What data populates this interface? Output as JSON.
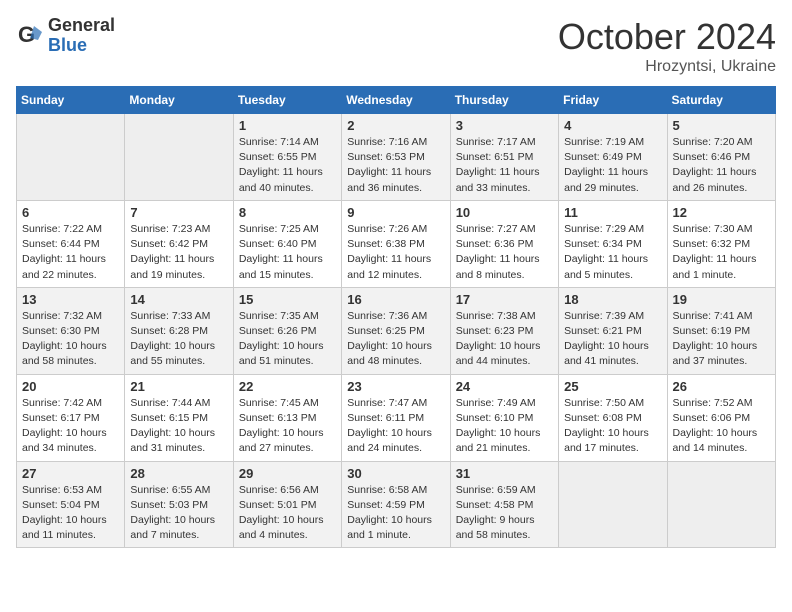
{
  "header": {
    "logo_general": "General",
    "logo_blue": "Blue",
    "month": "October 2024",
    "location": "Hrozyntsi, Ukraine"
  },
  "weekdays": [
    "Sunday",
    "Monday",
    "Tuesday",
    "Wednesday",
    "Thursday",
    "Friday",
    "Saturday"
  ],
  "weeks": [
    [
      {
        "day": "",
        "info": ""
      },
      {
        "day": "",
        "info": ""
      },
      {
        "day": "1",
        "info": "Sunrise: 7:14 AM\nSunset: 6:55 PM\nDaylight: 11 hours and 40 minutes."
      },
      {
        "day": "2",
        "info": "Sunrise: 7:16 AM\nSunset: 6:53 PM\nDaylight: 11 hours and 36 minutes."
      },
      {
        "day": "3",
        "info": "Sunrise: 7:17 AM\nSunset: 6:51 PM\nDaylight: 11 hours and 33 minutes."
      },
      {
        "day": "4",
        "info": "Sunrise: 7:19 AM\nSunset: 6:49 PM\nDaylight: 11 hours and 29 minutes."
      },
      {
        "day": "5",
        "info": "Sunrise: 7:20 AM\nSunset: 6:46 PM\nDaylight: 11 hours and 26 minutes."
      }
    ],
    [
      {
        "day": "6",
        "info": "Sunrise: 7:22 AM\nSunset: 6:44 PM\nDaylight: 11 hours and 22 minutes."
      },
      {
        "day": "7",
        "info": "Sunrise: 7:23 AM\nSunset: 6:42 PM\nDaylight: 11 hours and 19 minutes."
      },
      {
        "day": "8",
        "info": "Sunrise: 7:25 AM\nSunset: 6:40 PM\nDaylight: 11 hours and 15 minutes."
      },
      {
        "day": "9",
        "info": "Sunrise: 7:26 AM\nSunset: 6:38 PM\nDaylight: 11 hours and 12 minutes."
      },
      {
        "day": "10",
        "info": "Sunrise: 7:27 AM\nSunset: 6:36 PM\nDaylight: 11 hours and 8 minutes."
      },
      {
        "day": "11",
        "info": "Sunrise: 7:29 AM\nSunset: 6:34 PM\nDaylight: 11 hours and 5 minutes."
      },
      {
        "day": "12",
        "info": "Sunrise: 7:30 AM\nSunset: 6:32 PM\nDaylight: 11 hours and 1 minute."
      }
    ],
    [
      {
        "day": "13",
        "info": "Sunrise: 7:32 AM\nSunset: 6:30 PM\nDaylight: 10 hours and 58 minutes."
      },
      {
        "day": "14",
        "info": "Sunrise: 7:33 AM\nSunset: 6:28 PM\nDaylight: 10 hours and 55 minutes."
      },
      {
        "day": "15",
        "info": "Sunrise: 7:35 AM\nSunset: 6:26 PM\nDaylight: 10 hours and 51 minutes."
      },
      {
        "day": "16",
        "info": "Sunrise: 7:36 AM\nSunset: 6:25 PM\nDaylight: 10 hours and 48 minutes."
      },
      {
        "day": "17",
        "info": "Sunrise: 7:38 AM\nSunset: 6:23 PM\nDaylight: 10 hours and 44 minutes."
      },
      {
        "day": "18",
        "info": "Sunrise: 7:39 AM\nSunset: 6:21 PM\nDaylight: 10 hours and 41 minutes."
      },
      {
        "day": "19",
        "info": "Sunrise: 7:41 AM\nSunset: 6:19 PM\nDaylight: 10 hours and 37 minutes."
      }
    ],
    [
      {
        "day": "20",
        "info": "Sunrise: 7:42 AM\nSunset: 6:17 PM\nDaylight: 10 hours and 34 minutes."
      },
      {
        "day": "21",
        "info": "Sunrise: 7:44 AM\nSunset: 6:15 PM\nDaylight: 10 hours and 31 minutes."
      },
      {
        "day": "22",
        "info": "Sunrise: 7:45 AM\nSunset: 6:13 PM\nDaylight: 10 hours and 27 minutes."
      },
      {
        "day": "23",
        "info": "Sunrise: 7:47 AM\nSunset: 6:11 PM\nDaylight: 10 hours and 24 minutes."
      },
      {
        "day": "24",
        "info": "Sunrise: 7:49 AM\nSunset: 6:10 PM\nDaylight: 10 hours and 21 minutes."
      },
      {
        "day": "25",
        "info": "Sunrise: 7:50 AM\nSunset: 6:08 PM\nDaylight: 10 hours and 17 minutes."
      },
      {
        "day": "26",
        "info": "Sunrise: 7:52 AM\nSunset: 6:06 PM\nDaylight: 10 hours and 14 minutes."
      }
    ],
    [
      {
        "day": "27",
        "info": "Sunrise: 6:53 AM\nSunset: 5:04 PM\nDaylight: 10 hours and 11 minutes."
      },
      {
        "day": "28",
        "info": "Sunrise: 6:55 AM\nSunset: 5:03 PM\nDaylight: 10 hours and 7 minutes."
      },
      {
        "day": "29",
        "info": "Sunrise: 6:56 AM\nSunset: 5:01 PM\nDaylight: 10 hours and 4 minutes."
      },
      {
        "day": "30",
        "info": "Sunrise: 6:58 AM\nSunset: 4:59 PM\nDaylight: 10 hours and 1 minute."
      },
      {
        "day": "31",
        "info": "Sunrise: 6:59 AM\nSunset: 4:58 PM\nDaylight: 9 hours and 58 minutes."
      },
      {
        "day": "",
        "info": ""
      },
      {
        "day": "",
        "info": ""
      }
    ]
  ]
}
